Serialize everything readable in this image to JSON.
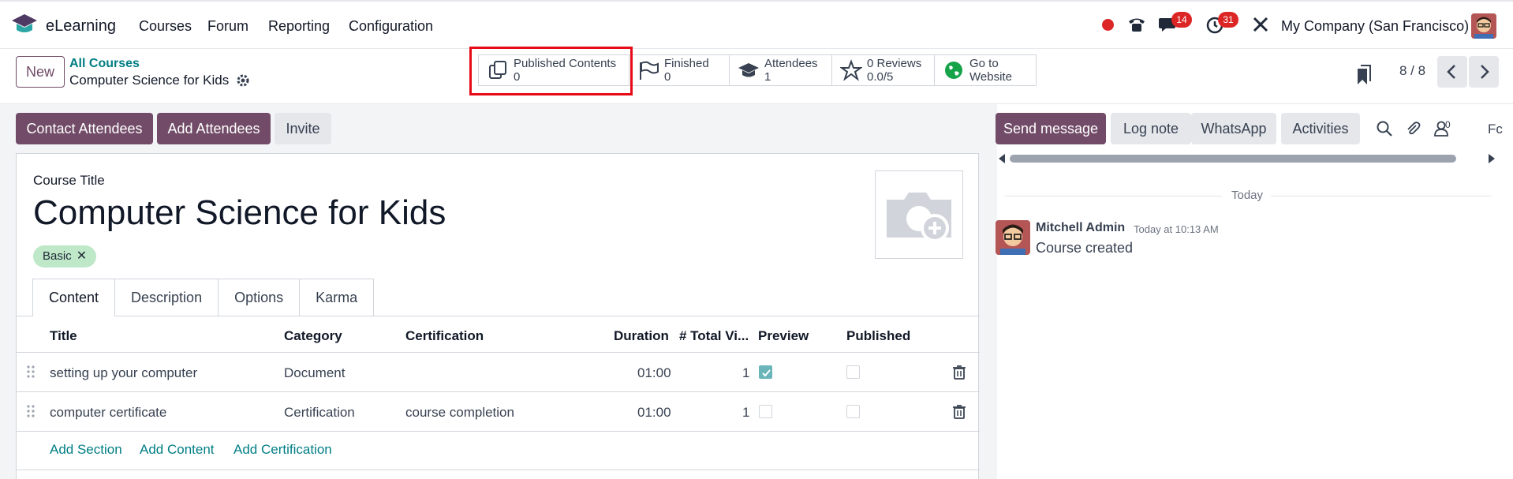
{
  "app": {
    "name": "eLearning"
  },
  "menu": [
    "Courses",
    "Forum",
    "Reporting",
    "Configuration"
  ],
  "systray": {
    "messages_count": "14",
    "activities_count": "31",
    "company": "My Company (San Francisco)"
  },
  "control_panel": {
    "new_label": "New",
    "breadcrumb_parent": "All Courses",
    "record_title": "Computer Science for Kids",
    "pager": "8 / 8"
  },
  "smart_buttons": [
    {
      "label": "Published Contents",
      "value": "0",
      "icon": "published-contents-icon"
    },
    {
      "label": "Finished",
      "value": "0",
      "icon": "finish-flag-icon"
    },
    {
      "label": "Attendees",
      "value": "1",
      "icon": "graduation-cap-icon"
    },
    {
      "label": "0 Reviews",
      "value": "0.0/5",
      "icon": "star-icon"
    },
    {
      "label": "Go to",
      "value": "Website",
      "icon": "globe-icon"
    }
  ],
  "actions": {
    "contact_attendees": "Contact Attendees",
    "add_attendees": "Add Attendees",
    "invite": "Invite"
  },
  "form": {
    "course_title_label": "Course Title",
    "course_title": "Computer Science for Kids",
    "tag": "Basic",
    "tabs": [
      "Content",
      "Description",
      "Options",
      "Karma"
    ],
    "columns": [
      "Title",
      "Category",
      "Certification",
      "Duration",
      "# Total Vi...",
      "Preview",
      "Published"
    ],
    "rows": [
      {
        "title": "setting up your computer",
        "category": "Document",
        "certification": "",
        "duration": "01:00",
        "views": "1",
        "preview": true,
        "published": false
      },
      {
        "title": "computer certificate",
        "category": "Certification",
        "certification": "course completion",
        "duration": "01:00",
        "views": "1",
        "preview": false,
        "published": false
      }
    ],
    "add_links": [
      "Add Section",
      "Add Content",
      "Add Certification"
    ]
  },
  "chatter": {
    "send_message": "Send message",
    "log_note": "Log note",
    "whatsapp": "WhatsApp",
    "activities": "Activities",
    "followers_count": "0",
    "follow_label": "Fc",
    "date_separator": "Today",
    "message": {
      "author": "Mitchell Admin",
      "time": "Today at 10:13 AM",
      "body": "Course created"
    }
  },
  "colors": {
    "primary": "#714b67",
    "link": "#017e84",
    "badge": "#dc2626",
    "highlight": "#e60b16",
    "tag_bg": "#bfe8c9"
  }
}
